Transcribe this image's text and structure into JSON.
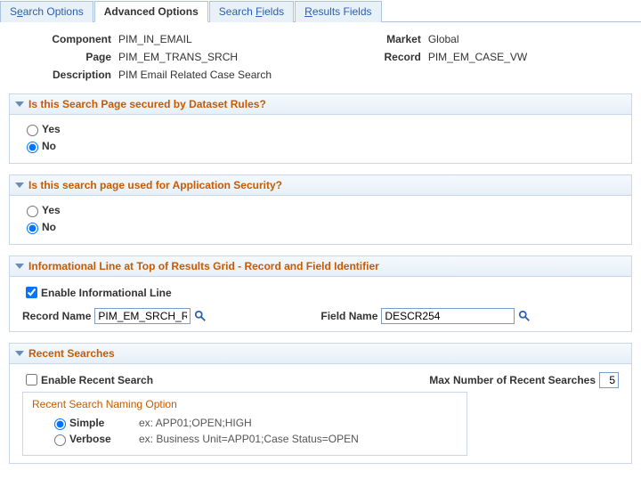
{
  "tabs": {
    "search_options_pre": "S",
    "search_options_u": "e",
    "search_options_post": "arch Options",
    "advanced_options": "Advanced Options",
    "search_fields_pre": "Search ",
    "search_fields_u": "F",
    "search_fields_post": "ields",
    "results_fields_pre": "",
    "results_fields_u": "R",
    "results_fields_post": "esults Fields"
  },
  "info": {
    "component_label": "Component",
    "component_value": "PIM_IN_EMAIL",
    "market_label": "Market",
    "market_value": "Global",
    "page_label": "Page",
    "page_value": "PIM_EM_TRANS_SRCH",
    "record_label": "Record",
    "record_value": "PIM_EM_CASE_VW",
    "description_label": "Description",
    "description_value": "PIM Email Related Case Search"
  },
  "panels": {
    "dataset": {
      "title": "Is this Search Page secured by Dataset Rules?",
      "yes": "Yes",
      "no": "No"
    },
    "appsec": {
      "title": "Is this search page used for Application Security?",
      "yes": "Yes",
      "no": "No"
    },
    "infoline": {
      "title": "Informational Line at Top of Results Grid - Record and Field Identifier",
      "enable_label": "Enable Informational Line",
      "record_label": "Record Name",
      "record_value": "PIM_EM_SRCH_R",
      "field_label": "Field Name",
      "field_value": "DESCR254"
    },
    "recent": {
      "title": "Recent Searches",
      "enable_label": "Enable Recent Search",
      "max_label": "Max Number of Recent Searches",
      "max_value": "5",
      "naming_title": "Recent Search Naming Option",
      "simple_label": "Simple",
      "simple_ex": "ex: APP01;OPEN;HIGH",
      "verbose_label": "Verbose",
      "verbose_ex": "ex: Business Unit=APP01;Case Status=OPEN"
    }
  }
}
